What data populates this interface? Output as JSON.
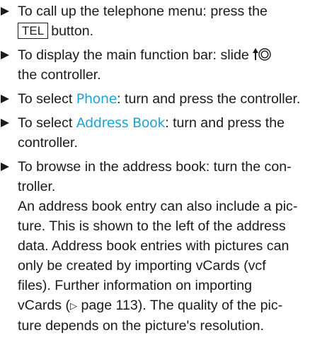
{
  "steps": [
    {
      "before": "To call up the telephone menu: press the",
      "key": "TEL",
      "after": "button."
    },
    {
      "before": "To display the main function bar: slide",
      "icon": "controller-slide-up-icon",
      "after": "the controller."
    },
    {
      "before": "To select",
      "highlight": "Phone",
      "after": ": turn and press the controller."
    },
    {
      "before": "To select",
      "highlight": "Address Book",
      "after": ": turn and press the controller."
    },
    {
      "line1": "To browse in the address book: turn the con-",
      "line2": "troller.",
      "note": {
        "l1": "An address book entry can also include a pic-",
        "l2": "ture. This is shown to the left of the address",
        "l3": "data. Address book entries with pictures can",
        "l4": "only be created by importing vCards (vcf",
        "l5": "files). Further information on importing",
        "l6_before": "vCards (",
        "l6_ref_icon": "▷",
        "l6_after": "page 113). The quality of the pic-",
        "l7": "ture depends on the picture's resolution."
      }
    }
  ],
  "colors": {
    "highlight": "#1aa3d4",
    "text": "#1a1a1a"
  }
}
